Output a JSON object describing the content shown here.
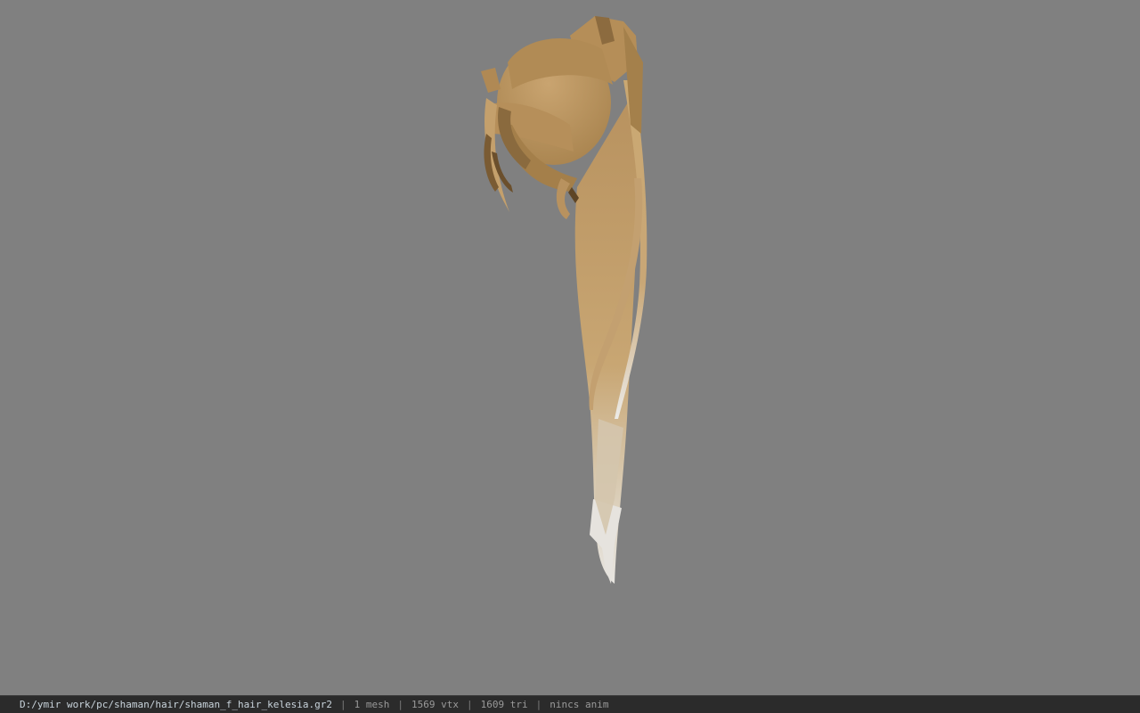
{
  "viewport": {
    "background": "#808080",
    "model_colors": {
      "hair_base": "#b8925f",
      "hair_light": "#c8a673",
      "hair_shadow": "#8a6a3e",
      "hair_tips": "#e4e1dc"
    }
  },
  "statusbar": {
    "file_path": "D:/ymir work/pc/shaman/hair/shaman_f_hair_kelesia.gr2",
    "separator": "|",
    "mesh_count": "1 mesh",
    "vertex_count": "1569 vtx",
    "triangle_count": "1609 tri",
    "anim_status": "nincs anim"
  }
}
